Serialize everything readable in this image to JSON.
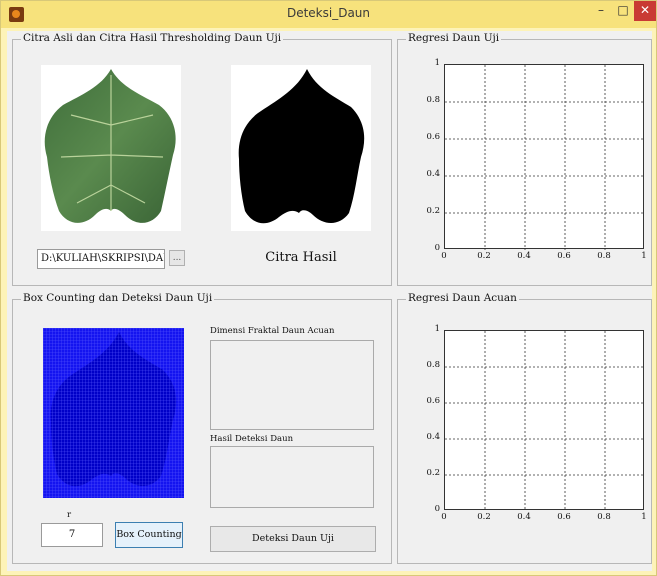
{
  "window": {
    "title": "Deteksi_Daun",
    "minimize": "–",
    "maximize": "□",
    "close": "✕"
  },
  "panel_citra": {
    "title": "Citra Asli dan Citra Hasil Thresholding Daun Uji",
    "path_value": "D:\\KULIAH\\SKRIPSI\\DAU",
    "browse_label": "...",
    "result_caption": "Citra Hasil"
  },
  "panel_box": {
    "title": "Box Counting dan Deteksi Daun Uji",
    "r_label": "r",
    "r_value": "7",
    "box_counting_label": "Box Counting",
    "dimensi_label": "Dimensi Fraktal Daun Acuan",
    "hasil_label": "Hasil Deteksi Daun",
    "deteksi_label": "Deteksi Daun Uji"
  },
  "panel_regresi_uji": {
    "title": "Regresi Daun Uji",
    "x_ticks": [
      "0",
      "0.2",
      "0.4",
      "0.6",
      "0.8",
      "1"
    ],
    "y_ticks": [
      "0",
      "0.2",
      "0.4",
      "0.6",
      "0.8",
      "1"
    ]
  },
  "panel_regresi_acuan": {
    "title": "Regresi Daun Acuan",
    "x_ticks": [
      "0",
      "0.2",
      "0.4",
      "0.6",
      "0.8",
      "1"
    ],
    "y_ticks": [
      "0",
      "0.2",
      "0.4",
      "0.6",
      "0.8",
      "1"
    ]
  },
  "colors": {
    "leaf_green": "#4e7a45",
    "box_blue": "#1a1aff",
    "grid_blue": "#0000e6"
  },
  "icons": [
    "app-icon",
    "minimize-icon",
    "maximize-icon",
    "close-icon"
  ]
}
